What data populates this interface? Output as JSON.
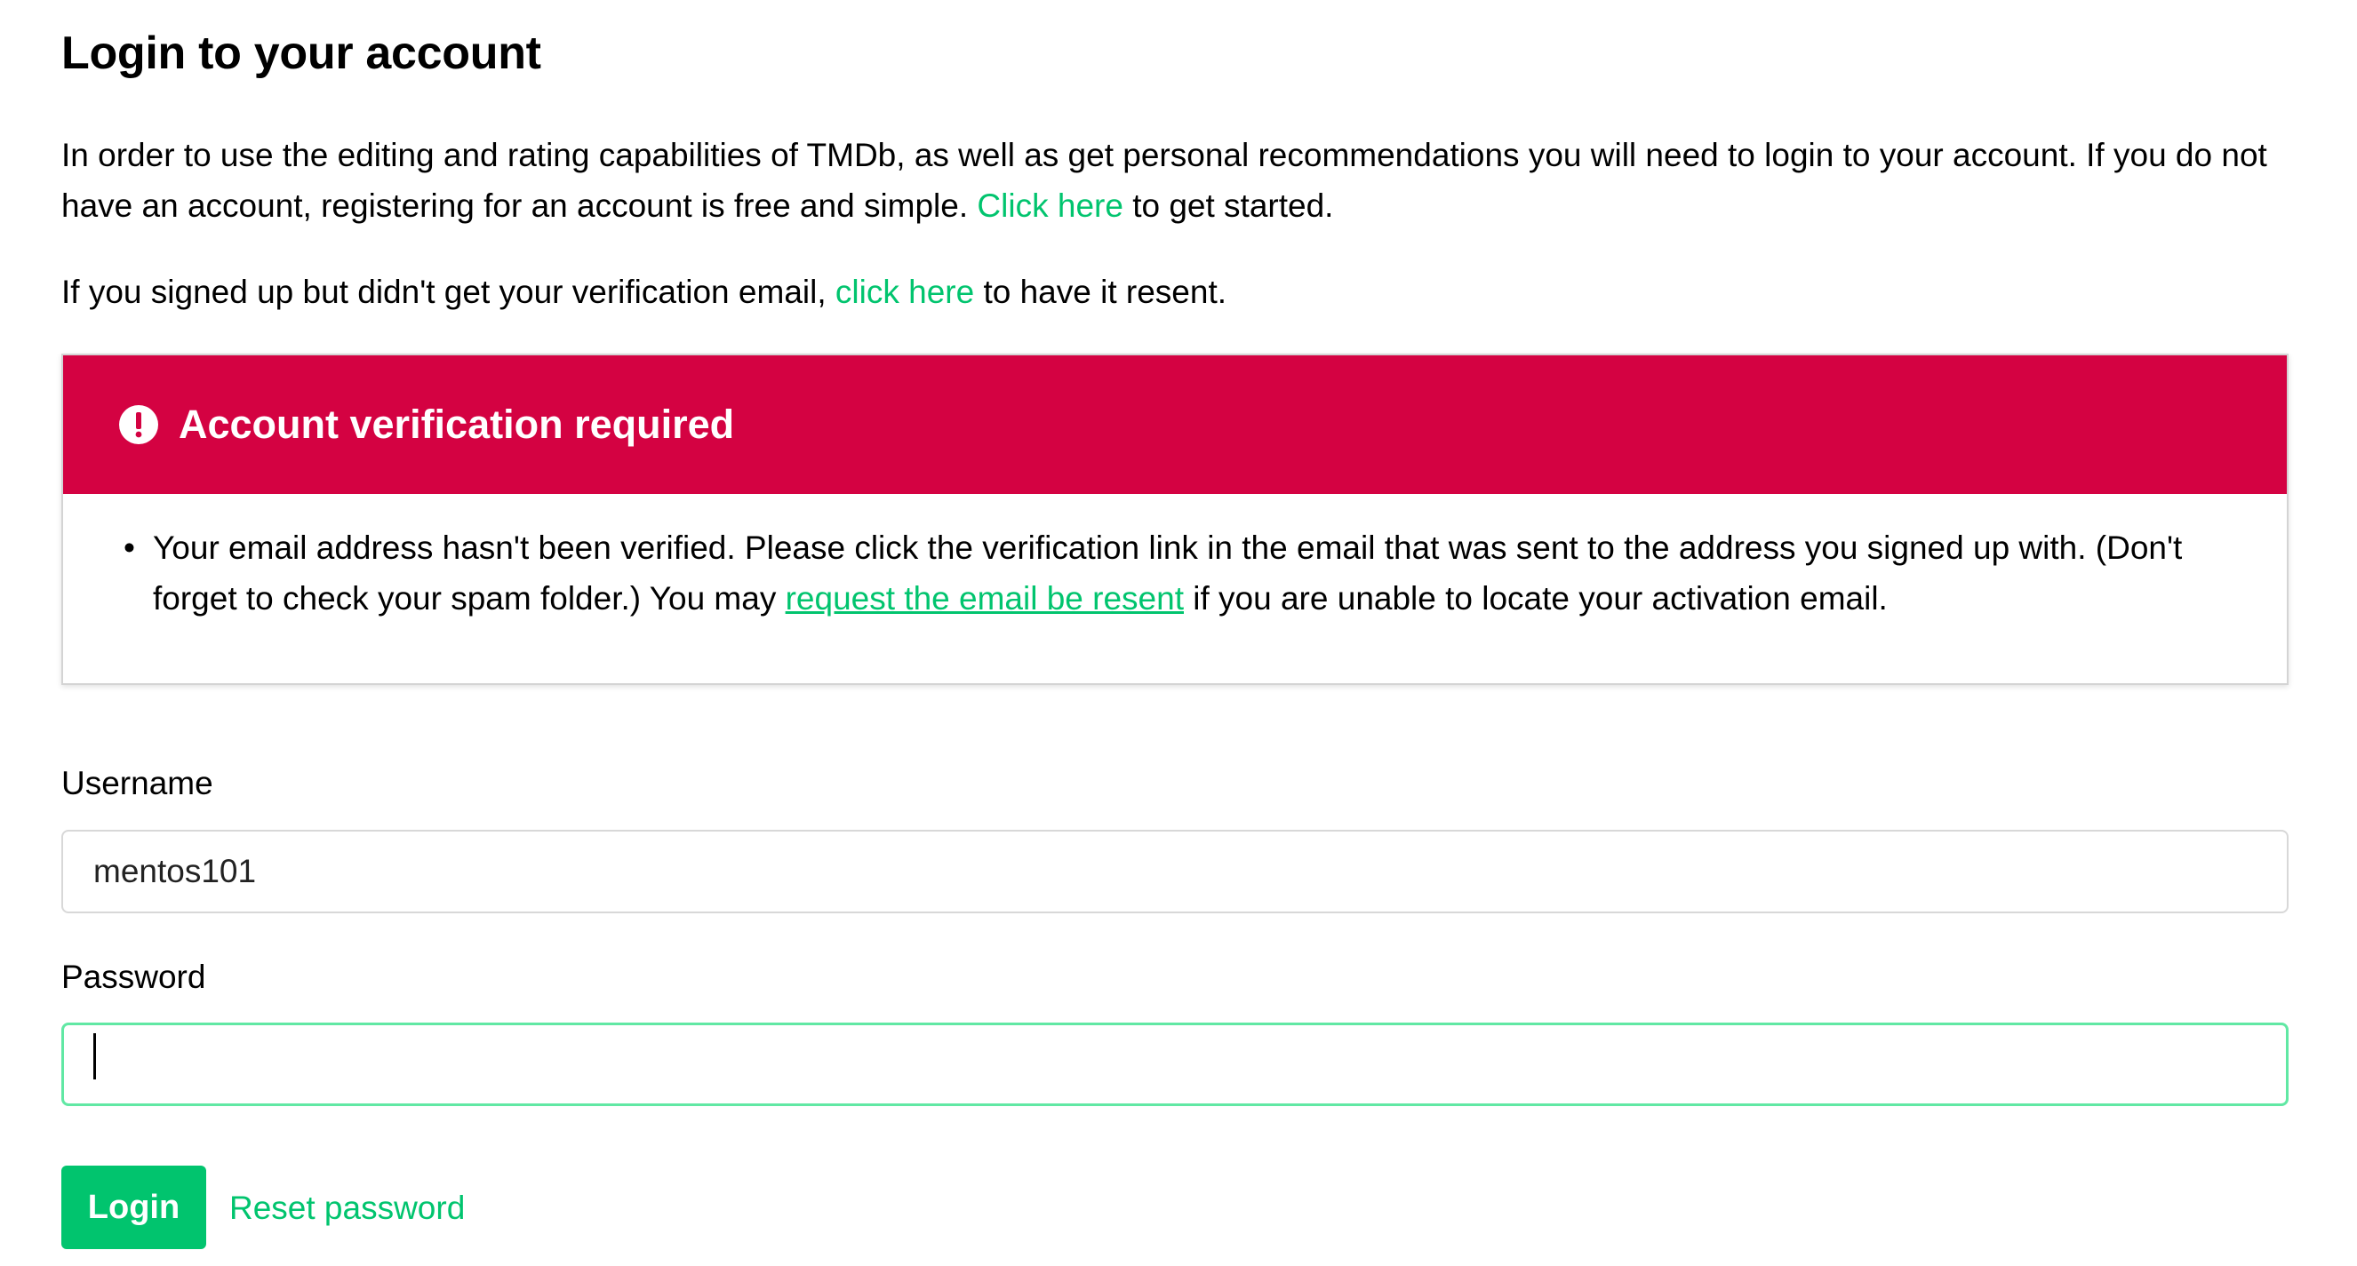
{
  "title": "Login to your account",
  "intro": {
    "text_before": "In order to use the editing and rating capabilities of TMDb, as well as get personal recommendations you will need to login to your account. If you do not have an account, registering for an account is free and simple. ",
    "link": "Click here",
    "text_after": " to get started."
  },
  "resend": {
    "text_before": "If you signed up but didn't get your verification email, ",
    "link": "click here",
    "text_after": " to have it resent."
  },
  "alert": {
    "title": "Account verification required",
    "color": "#d40242",
    "icon": "exclamation-circle-icon",
    "bullet": "•",
    "message_before": "Your email address hasn't been verified. Please click the verification link in the email that was sent to the address you signed up with. (Don't forget to check your spam folder.) You may ",
    "message_link": "request the email be resent",
    "message_after": " if you are unable to locate your activation email."
  },
  "form": {
    "username_label": "Username",
    "username_value": "mentos101",
    "password_label": "Password",
    "password_value": "",
    "login_label": "Login",
    "reset_label": "Reset password"
  },
  "colors": {
    "accent": "#01c46e",
    "focus_border": "#61e8a4"
  }
}
